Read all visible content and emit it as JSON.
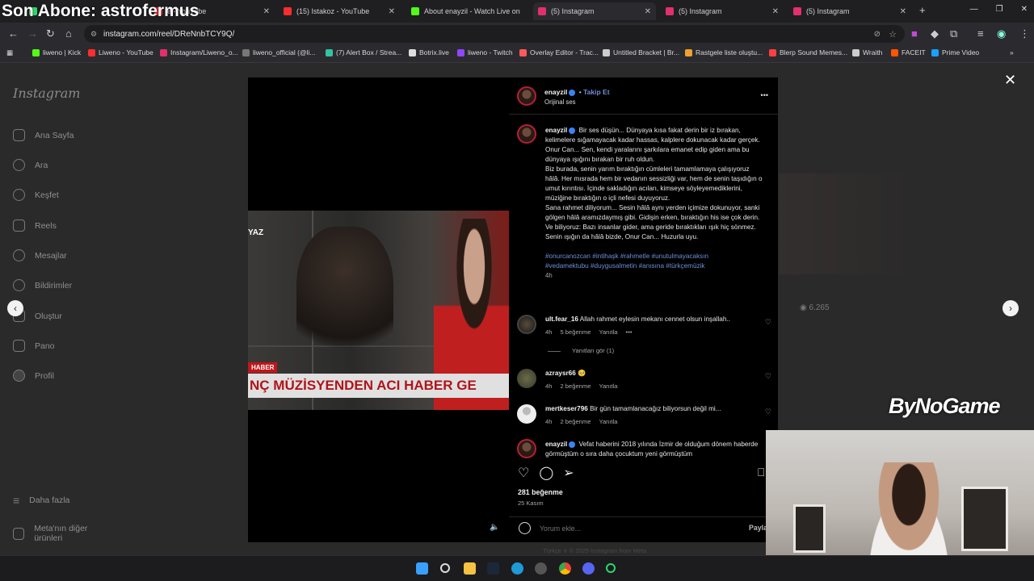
{
  "overlay_title": "Son Abone: astrofermus",
  "browser": {
    "tabs": [
      {
        "label": "",
        "fav_color": "#2bd96a"
      },
      {
        "label": "e - YouTube",
        "fav_color": "#ff2d2d"
      },
      {
        "label": "(15) Istakoz - YouTube",
        "fav_color": "#ff2d2d"
      },
      {
        "label": "About enayzil - Watch Live on Kick",
        "fav_color": "#53fc18"
      },
      {
        "label": "(5) Instagram",
        "fav_color": "#e1306c"
      },
      {
        "label": "(5) Instagram",
        "fav_color": "#e1306c"
      },
      {
        "label": "(5) Instagram",
        "fav_color": "#e1306c"
      }
    ],
    "new_tab": "+",
    "url": "instagram.com/reel/DReNnbTCY9Q/",
    "bookmarks": [
      {
        "label": "liweno | Kick",
        "color": "#53fc18"
      },
      {
        "label": "Liweno - YouTube",
        "color": "#ff2d2d"
      },
      {
        "label": "Instagram/Liweno_o...",
        "color": "#e1306c"
      },
      {
        "label": "liweno_official (@li...",
        "color": "#777777"
      },
      {
        "label": "(7) Alert Box / Strea...",
        "color": "#31c3a2"
      },
      {
        "label": "Botrix.live",
        "color": "#dddddd"
      },
      {
        "label": "liweno - Twitch",
        "color": "#9146ff"
      },
      {
        "label": "Overlay Editor - Trac...",
        "color": "#ff5a5a"
      },
      {
        "label": "Untitled Bracket | Br...",
        "color": "#cccccc"
      },
      {
        "label": "Rastgele liste oluştu...",
        "color": "#f0a030"
      },
      {
        "label": "Blerp Sound Memes...",
        "color": "#ff4040"
      },
      {
        "label": "Wraith",
        "color": "#cccccc"
      },
      {
        "label": "FACEIT",
        "color": "#ff5500"
      },
      {
        "label": "Prime Video",
        "color": "#1aa0ff"
      }
    ]
  },
  "sidebar": {
    "logo": "Instagram",
    "items": [
      {
        "label": "Ana Sayfa",
        "icon": "home-icon"
      },
      {
        "label": "Ara",
        "icon": "search-icon"
      },
      {
        "label": "Keşfet",
        "icon": "compass-icon"
      },
      {
        "label": "Reels",
        "icon": "reels-icon"
      },
      {
        "label": "Mesajlar",
        "icon": "messenger-icon"
      },
      {
        "label": "Bildirimler",
        "icon": "heart-icon"
      },
      {
        "label": "Oluştur",
        "icon": "plus-icon"
      },
      {
        "label": "Pano",
        "icon": "dashboard-icon"
      },
      {
        "label": "Profil",
        "icon": "profile-icon"
      }
    ],
    "more": "Daha fazla",
    "meta": "Meta'nın diğer ürünleri"
  },
  "video": {
    "yaz": "YAZ",
    "haber_tag": "HABER",
    "ticker": "NÇ MÜZİSYENDEN ACI HABER GE"
  },
  "post": {
    "author": "enayzil",
    "follow": "Takip Et",
    "dot": "•",
    "audio": "Orijinal ses",
    "more": "•••",
    "caption": "Bir ses düşün... Dünyaya kısa fakat derin bir iz bırakan, kelimelere sığamayacak kadar hassas, kalplere dokunacak kadar gerçek. Onur Can... Sen, kendi yaralarını şarkılara emanet edip giden ama bu dünyaya ışığını bırakan bir ruh oldun.",
    "caption_2": "Biz burada, senin yarım bıraktığın cümleleri tamamlamaya çalışıyoruz hâlâ. Her mısrada hem bir vedanın sessizliği var, hem de senin taşıdığın o umut kırıntısı. İçinde sakladığın acıları, kimseye söyleyemediklerini, müziğine bıraktığın o içli nefesi duyuyoruz.",
    "caption_3": "Sana rahmet diliyorum... Sesin hâlâ aynı yerden içimize dokunuyor, sanki gölgen hâlâ aramızdaymış gibi. Gidişin erken, bıraktığın his ise çok derin.",
    "caption_4": "Ve biliyoruz: Bazı insanlar gider, ama geride bıraktıkları ışık hiç sönmez. Senin ışığın da hâlâ bizde, Onur Can... Huzurla uyu.",
    "hashtags_1": "#onurcanozcan #intihaşk #rahmetle #unutulmayacaksın",
    "hashtags_2": "#vedamektubu #duygusalmetin #anısına #türkçemüzik",
    "time": "4h",
    "likes": "281 beğenme",
    "date": "25 Kasım",
    "comment_placeholder": "Yorum ekle...",
    "post_button": "Paylaş",
    "footer": "Türkçe ∨     © 2025 Instagram from Meta"
  },
  "comments": [
    {
      "user": "ult.fear_16",
      "text": "Allah rahmet eylesin mekanı cennet olsun inşallah..",
      "time": "4h",
      "likes": "5 beğenme",
      "reply": "Yanıtla",
      "extra": "•••"
    },
    {
      "user": "azraysr66",
      "text": "🥺",
      "time": "4h",
      "likes": "2 beğenme",
      "reply": "Yanıtla"
    },
    {
      "user": "mertkeser796",
      "text": "Bir gün tamamlanacağız biliyorsun değil mi...",
      "time": "4h",
      "likes": "2 beğenme",
      "reply": "Yanıtla"
    },
    {
      "user": "enayzil",
      "text": "Vefat haberini 2018 yılında İzmir de olduğum dönem haberde görmüştüm o sıra daha çocuktum yeni görmüştüm"
    }
  ],
  "view_replies": "Yanıtları gör (1)",
  "side": {
    "views": "6.265"
  },
  "watermark": "ByNoGame",
  "colors": {
    "accent": "#0095f6",
    "hashtag": "#6f8fd9",
    "panel_bg": "#000000",
    "page_bg": "#2a2a2a"
  }
}
